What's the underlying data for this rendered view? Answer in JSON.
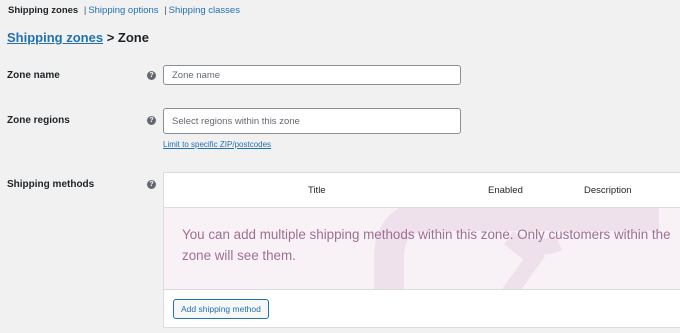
{
  "subnav": {
    "items": [
      "Shipping zones",
      "Shipping options",
      "Shipping classes"
    ],
    "separator": "|"
  },
  "breadcrumb": {
    "parent": "Shipping zones",
    "separator": ">",
    "current": "Zone"
  },
  "form": {
    "zone_name": {
      "label": "Zone name",
      "placeholder": "Zone name",
      "value": ""
    },
    "zone_regions": {
      "label": "Zone regions",
      "placeholder": "Select regions within this zone",
      "value": "",
      "limit_link": "Limit to specific ZIP/postcodes"
    },
    "shipping_methods": {
      "label": "Shipping methods",
      "columns": [
        "Title",
        "Enabled",
        "Description"
      ],
      "empty_message": "You can add multiple shipping methods within this zone. Only customers within the zone will see them.",
      "add_button": "Add shipping method"
    },
    "help_glyph": "?"
  },
  "colors": {
    "link": "#2271b1",
    "empty_bg": "#f8f2f6",
    "empty_text": "#9f6f94",
    "page_bg": "#f1f1f1"
  },
  "icons": [
    "help-icon",
    "truck-watermark-icon"
  ]
}
